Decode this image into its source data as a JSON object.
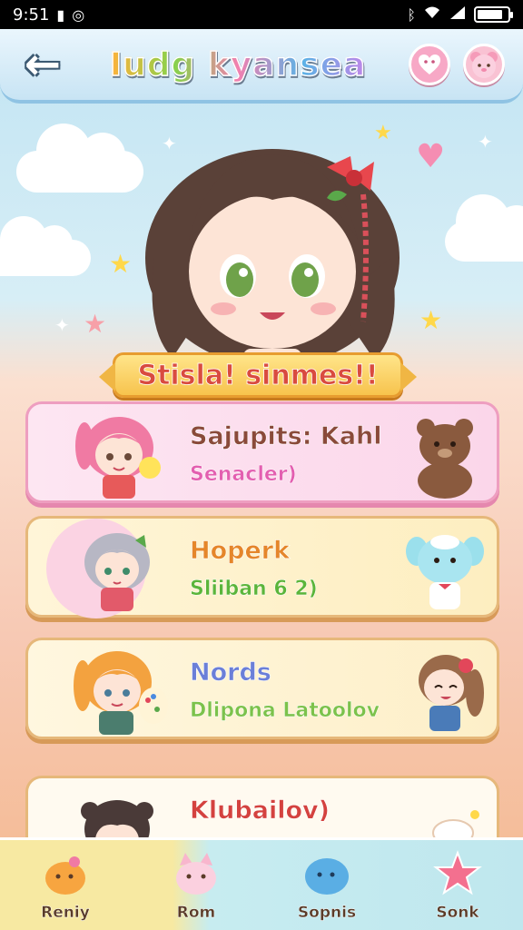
{
  "status_bar": {
    "time": "9:51",
    "left_icons": [
      "sim-icon",
      "notification-icon"
    ],
    "right_icons": [
      "bluetooth-icon",
      "wifi-icon",
      "signal-icon",
      "battery-icon"
    ],
    "battery_level": 0.85
  },
  "header": {
    "back_icon": "back-arrow-icon",
    "title": "Iudg kyansea",
    "action_icons": [
      "heart-bubble-icon",
      "bear-face-icon"
    ]
  },
  "hero": {
    "banner_text": "Stisla! sinmes!!"
  },
  "cards": [
    {
      "name": "Sajupits: Kahl",
      "subtitle": "Senacler)",
      "name_color": "#8a4a3a",
      "sub_color": "#e35fb0",
      "avatar_icon": "pink-hair-girl-avatar",
      "right_icon": "brown-bear-icon"
    },
    {
      "name": "Hoperk",
      "subtitle": "Sliiban 6 2)",
      "name_color": "#e5862a",
      "sub_color": "#5bb53a",
      "avatar_icon": "silver-hair-girl-avatar",
      "right_icon": "blue-bunny-icon"
    },
    {
      "name": "Nords",
      "subtitle": "Dlipona Latoolov",
      "name_color": "#6b7fd8",
      "sub_color": "#7cc24b",
      "avatar_icon": "orange-hair-girl-avatar",
      "right_icon": "brown-hair-girl-icon"
    },
    {
      "name": "Klubailov)",
      "subtitle": "",
      "name_color": "#d4423f",
      "sub_color": "#5bb53a",
      "avatar_icon": "dark-hair-girl-avatar",
      "right_icon": "cloud-icon"
    }
  ],
  "bottom_nav": [
    {
      "label": "Reniy",
      "icon": "orange-blob-icon"
    },
    {
      "label": "Rom",
      "icon": "pink-cat-icon"
    },
    {
      "label": "Sopnis",
      "icon": "blue-blob-icon"
    },
    {
      "label": "Sonk",
      "icon": "pink-star-icon"
    }
  ]
}
